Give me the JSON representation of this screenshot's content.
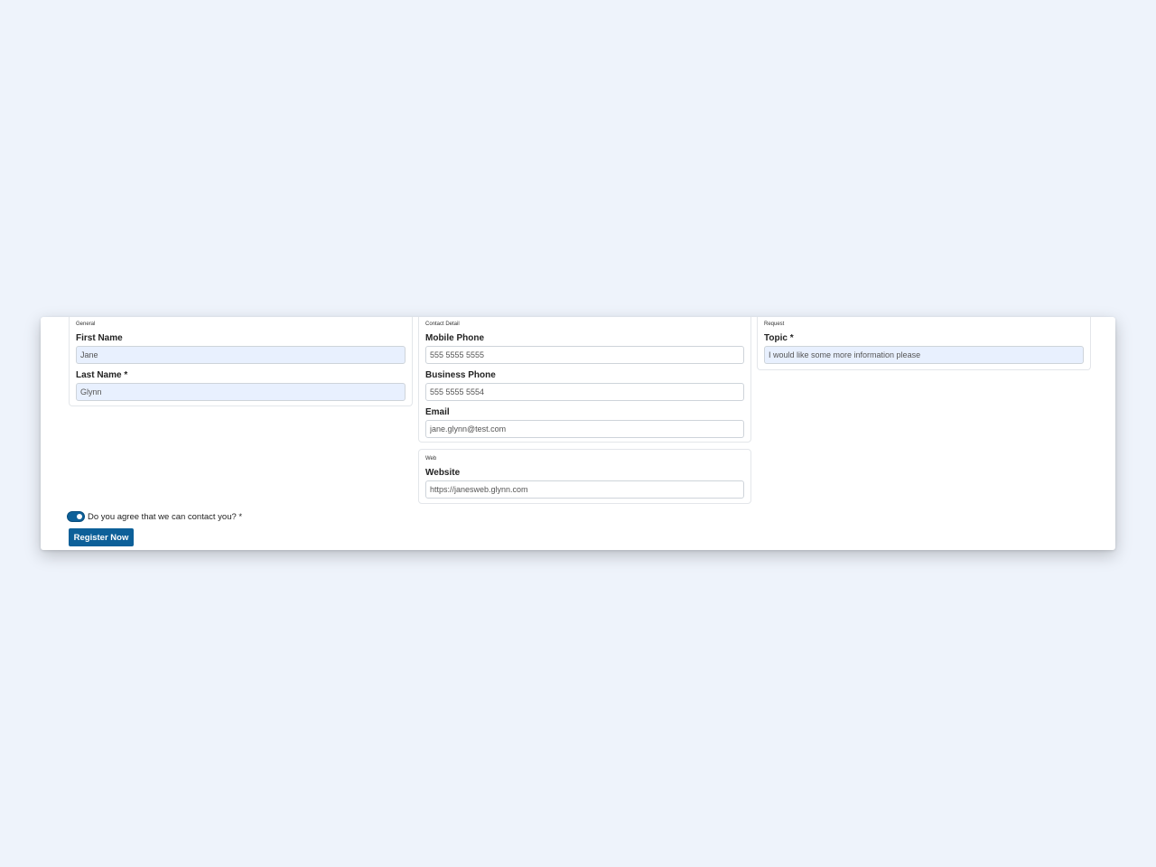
{
  "general": {
    "title": "General",
    "first_name_label": "First Name",
    "first_name_value": "Jane",
    "last_name_label": "Last Name *",
    "last_name_value": "Glynn"
  },
  "contact": {
    "title": "Contact Detail",
    "mobile_label": "Mobile Phone",
    "mobile_value": "555 5555 5555",
    "business_label": "Business Phone",
    "business_value": "555 5555 5554",
    "email_label": "Email",
    "email_value": "jane.glynn@test.com"
  },
  "web": {
    "title": "Web",
    "website_label": "Website",
    "website_value": "https://janesweb.glynn.com"
  },
  "request": {
    "title": "Request",
    "topic_label": "Topic *",
    "topic_value": "I would like some more information please"
  },
  "consent": {
    "label": "Do you agree that we can contact you? *",
    "checked": true
  },
  "actions": {
    "register_label": "Register Now"
  },
  "colors": {
    "background": "#eef3fb",
    "primary": "#0d6099",
    "autofill": "#e8f0fe"
  }
}
